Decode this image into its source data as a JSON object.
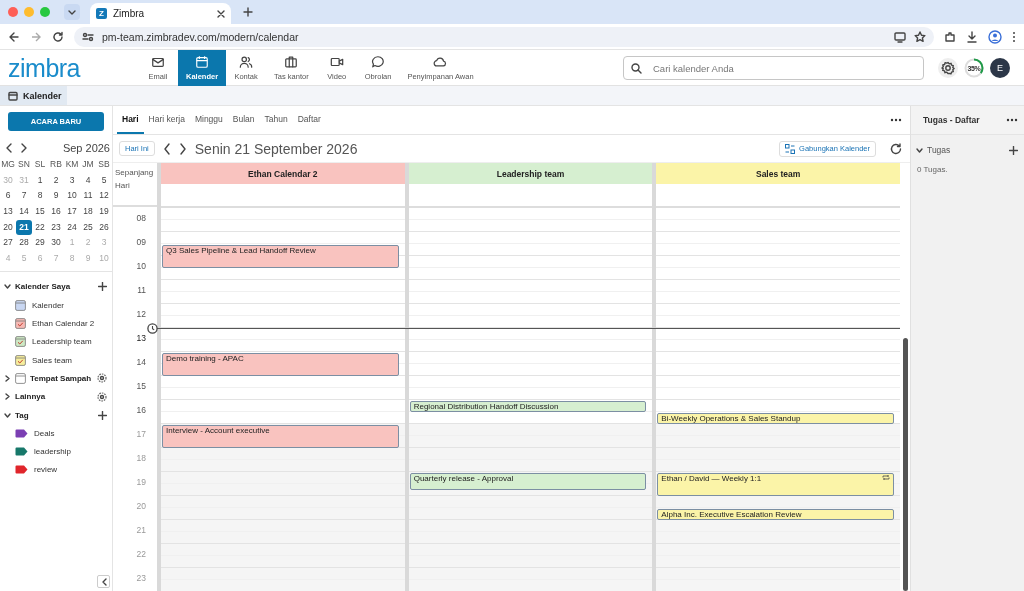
{
  "browser": {
    "tab_title": "Zimbra",
    "favicon_letter": "Z",
    "url": "pm-team.zimbradev.com/modern/calendar"
  },
  "app_header": {
    "logo": "zimbra",
    "nav": [
      {
        "label": "Email",
        "selected": false
      },
      {
        "label": "Kalender",
        "selected": true
      },
      {
        "label": "Kontak",
        "selected": false
      },
      {
        "label": "Tas kantor",
        "selected": false
      },
      {
        "label": "Video",
        "selected": false
      },
      {
        "label": "Obrolan",
        "selected": false
      },
      {
        "label": "Penyimpanan Awan",
        "selected": false
      }
    ],
    "search": {
      "placeholder": "Cari kalender Anda"
    },
    "quota": {
      "label": "35%",
      "level": 0.35
    },
    "avatar": {
      "initial": "E"
    }
  },
  "subbar": {
    "tab": "Kalender"
  },
  "sidebar": {
    "new_button": "ACARA BARU",
    "mini_calendar": {
      "month": "Sep 2026",
      "weekdays": [
        "MG",
        "SN",
        "SL",
        "RB",
        "KM",
        "JM",
        "SB"
      ],
      "weeks": [
        [
          {
            "day": "30",
            "muted": true,
            "selected": false
          },
          {
            "day": "31",
            "muted": true,
            "selected": false
          },
          {
            "day": "1",
            "muted": false,
            "selected": false
          },
          {
            "day": "2",
            "muted": false,
            "selected": false
          },
          {
            "day": "3",
            "muted": false,
            "selected": false
          },
          {
            "day": "4",
            "muted": false,
            "selected": false
          },
          {
            "day": "5",
            "muted": false,
            "selected": false
          }
        ],
        [
          {
            "day": "6",
            "muted": false,
            "selected": false
          },
          {
            "day": "7",
            "muted": false,
            "selected": false
          },
          {
            "day": "8",
            "muted": false,
            "selected": false
          },
          {
            "day": "9",
            "muted": false,
            "selected": false
          },
          {
            "day": "10",
            "muted": false,
            "selected": false
          },
          {
            "day": "11",
            "muted": false,
            "selected": false
          },
          {
            "day": "12",
            "muted": false,
            "selected": false
          }
        ],
        [
          {
            "day": "13",
            "muted": false,
            "selected": false
          },
          {
            "day": "14",
            "muted": false,
            "selected": false
          },
          {
            "day": "15",
            "muted": false,
            "selected": false
          },
          {
            "day": "16",
            "muted": false,
            "selected": false
          },
          {
            "day": "17",
            "muted": false,
            "selected": false
          },
          {
            "day": "18",
            "muted": false,
            "selected": false
          },
          {
            "day": "19",
            "muted": false,
            "selected": false
          }
        ],
        [
          {
            "day": "20",
            "muted": false,
            "selected": false
          },
          {
            "day": "21",
            "muted": false,
            "selected": true
          },
          {
            "day": "22",
            "muted": false,
            "selected": false
          },
          {
            "day": "23",
            "muted": false,
            "selected": false
          },
          {
            "day": "24",
            "muted": false,
            "selected": false
          },
          {
            "day": "25",
            "muted": false,
            "selected": false
          },
          {
            "day": "26",
            "muted": false,
            "selected": false
          }
        ],
        [
          {
            "day": "27",
            "muted": false,
            "selected": false
          },
          {
            "day": "28",
            "muted": false,
            "selected": false
          },
          {
            "day": "29",
            "muted": false,
            "selected": false
          },
          {
            "day": "30",
            "muted": false,
            "selected": false
          },
          {
            "day": "1",
            "muted": true,
            "selected": false
          },
          {
            "day": "2",
            "muted": true,
            "selected": false
          },
          {
            "day": "3",
            "muted": true,
            "selected": false
          }
        ],
        [
          {
            "day": "4",
            "muted": true,
            "selected": false
          },
          {
            "day": "5",
            "muted": true,
            "selected": false
          },
          {
            "day": "6",
            "muted": true,
            "selected": false
          },
          {
            "day": "7",
            "muted": true,
            "selected": false
          },
          {
            "day": "8",
            "muted": true,
            "selected": false
          },
          {
            "day": "9",
            "muted": true,
            "selected": false
          },
          {
            "day": "10",
            "muted": true,
            "selected": false
          }
        ]
      ]
    },
    "sections": [
      {
        "title": "Kalender Saya",
        "kind": "group",
        "expanded": true,
        "add_button": true,
        "settings_button": false,
        "items": [
          {
            "label": "Kalender",
            "kind": "calendar",
            "color": "#c9d7f2",
            "checked": false
          },
          {
            "label": "Ethan Calendar 2",
            "kind": "calendar",
            "color": "#f6b9b4",
            "checked": true
          },
          {
            "label": "Leadership team",
            "kind": "calendar",
            "color": "#cde9c4",
            "checked": true
          },
          {
            "label": "Sales team",
            "kind": "calendar",
            "color": "#f7ee9c",
            "checked": true
          }
        ]
      },
      {
        "title": "Tempat Sampah",
        "kind": "calendar",
        "expanded": false,
        "add_button": false,
        "settings_button": true
      },
      {
        "title": "Lainnya",
        "kind": "group",
        "expanded": false,
        "add_button": false,
        "settings_button": true
      },
      {
        "title": "Tag",
        "kind": "group",
        "expanded": true,
        "add_button": true,
        "settings_button": false,
        "items": [
          {
            "label": "Deals",
            "kind": "tag",
            "color": "#7b3fb3"
          },
          {
            "label": "leadership",
            "kind": "tag",
            "color": "#17786a"
          },
          {
            "label": "review",
            "kind": "tag",
            "color": "#e0252b"
          }
        ]
      }
    ]
  },
  "view_tabs": [
    {
      "label": "Hari",
      "selected": true
    },
    {
      "label": "Hari kerja",
      "selected": false
    },
    {
      "label": "Minggu",
      "selected": false
    },
    {
      "label": "Bulan",
      "selected": false
    },
    {
      "label": "Tahun",
      "selected": false
    },
    {
      "label": "Daftar",
      "selected": false
    }
  ],
  "date_bar": {
    "today_button": "Hari Ini",
    "date": "Senin 21 September 2026",
    "merge_button": "Gabungkan Kalender"
  },
  "grid": {
    "all_day_label": "Sepanjang Hari",
    "columns": [
      {
        "name": "Ethan Calendar 2",
        "color": "#f9c3bf"
      },
      {
        "name": "Leadership team",
        "color": "#d6efd0"
      },
      {
        "name": "Sales team",
        "color": "#fbf4a8"
      }
    ],
    "hours": [
      {
        "label": "08",
        "working": true,
        "current": false
      },
      {
        "label": "09",
        "working": true,
        "current": false,
        "cells": [
          {
            "events": [
              {
                "title": "Q3 Sales Pipeline & Lead Handoff Review",
                "kind": "hour",
                "half_past": true,
                "recurring": false
              }
            ]
          },
          {},
          {}
        ]
      },
      {
        "label": "10",
        "working": true,
        "current": false
      },
      {
        "label": "11",
        "working": true,
        "current": false
      },
      {
        "label": "12",
        "working": true,
        "current": false
      },
      {
        "label": "13",
        "working": true,
        "current": true
      },
      {
        "label": "14",
        "working": true,
        "current": false,
        "cells": [
          {
            "events": [
              {
                "title": "Demo training - APAC",
                "kind": "hour",
                "half_past": false,
                "recurring": false
              }
            ]
          },
          {},
          {}
        ]
      },
      {
        "label": "15",
        "working": true,
        "current": false
      },
      {
        "label": "16",
        "working": true,
        "current": false,
        "cells": [
          {},
          {
            "events": [
              {
                "title": "Regional Distribution Handoff Discussion",
                "kind": "half",
                "half_past": false,
                "recurring": false
              }
            ]
          },
          {
            "events": [
              {
                "title": "Bi-Weekly Operations & Sales Standup",
                "kind": "half",
                "half_past": true,
                "recurring": false
              }
            ]
          }
        ]
      },
      {
        "label": "17",
        "working": false,
        "current": false,
        "cells": [
          {
            "events": [
              {
                "title": "Interview - Account executive",
                "kind": "hour",
                "half_past": false,
                "recurring": false
              }
            ]
          },
          {},
          {}
        ]
      },
      {
        "label": "18",
        "working": false,
        "current": false
      },
      {
        "label": "19",
        "working": false,
        "current": false,
        "cells": [
          {},
          {
            "events": [
              {
                "title": "Quarterly release - Approval",
                "kind": "three_quarter",
                "half_past": false,
                "recurring": false
              }
            ]
          },
          {
            "events": [
              {
                "title": "Ethan / David — Weekly 1:1",
                "kind": "hour",
                "half_past": false,
                "recurring": true
              }
            ]
          }
        ]
      },
      {
        "label": "20",
        "working": false,
        "current": false,
        "cells": [
          {},
          {},
          {
            "events": [
              {
                "title": "Alpha Inc. Executive Escalation Review",
                "kind": "half",
                "half_past": true,
                "recurring": false
              }
            ]
          }
        ]
      },
      {
        "label": "21",
        "working": false,
        "current": false
      },
      {
        "label": "22",
        "working": false,
        "current": false
      },
      {
        "label": "23",
        "working": false,
        "current": false
      }
    ]
  },
  "tasks_panel": {
    "title": "Tugas - Daftar",
    "section": "Tugas",
    "expanded": true,
    "count": "0 Tugas."
  }
}
